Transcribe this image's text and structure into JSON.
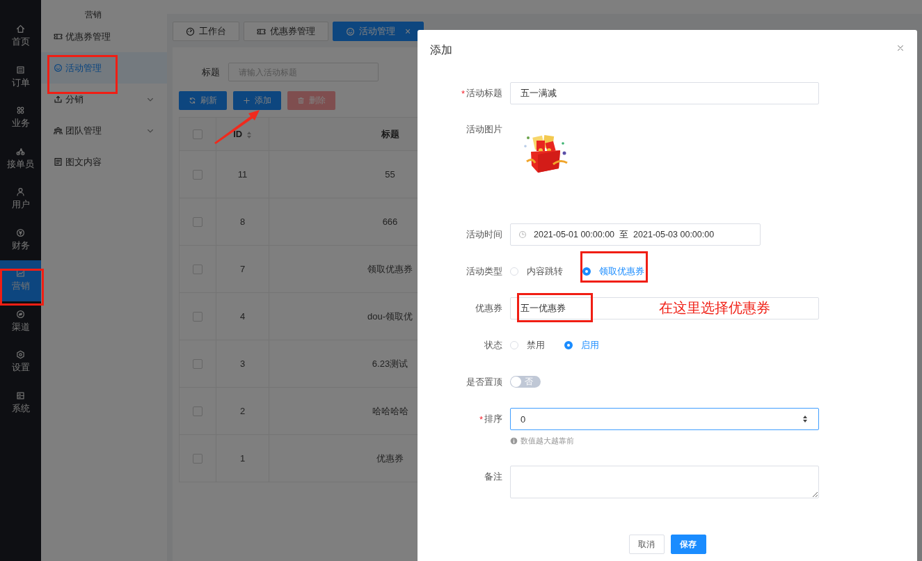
{
  "rail": {
    "items": [
      {
        "label": "首页",
        "selected": false
      },
      {
        "label": "订单",
        "selected": false
      },
      {
        "label": "业务",
        "selected": false
      },
      {
        "label": "接单员",
        "selected": false
      },
      {
        "label": "用户",
        "selected": false
      },
      {
        "label": "财务",
        "selected": false
      },
      {
        "label": "营销",
        "selected": true
      },
      {
        "label": "渠道",
        "selected": false
      },
      {
        "label": "设置",
        "selected": false
      },
      {
        "label": "系统",
        "selected": false
      }
    ]
  },
  "submenu": {
    "heading": "营销",
    "items": [
      {
        "label": "优惠券管理",
        "selected": false,
        "expandable": false
      },
      {
        "label": "活动管理",
        "selected": true,
        "expandable": false
      },
      {
        "label": "分销",
        "selected": false,
        "expandable": true
      },
      {
        "label": "团队管理",
        "selected": false,
        "expandable": true
      },
      {
        "label": "图文内容",
        "selected": false,
        "expandable": false
      }
    ]
  },
  "tabs": [
    {
      "label": "工作台",
      "selected": false,
      "closable": false
    },
    {
      "label": "优惠券管理",
      "selected": false,
      "closable": false
    },
    {
      "label": "活动管理",
      "selected": true,
      "closable": true,
      "close": "×"
    }
  ],
  "filter": {
    "label": "标题",
    "placeholder": "请输入活动标题"
  },
  "toolbar": [
    {
      "label": "刷新",
      "kind": "primary",
      "disabled": false
    },
    {
      "label": "添加",
      "kind": "primary",
      "disabled": false
    },
    {
      "label": "删除",
      "kind": "danger",
      "disabled": true
    }
  ],
  "table": {
    "select_all": false,
    "columns": [
      {
        "label": "ID",
        "sortable": true
      },
      {
        "label": "标题",
        "sortable": false
      }
    ],
    "rows": [
      {
        "id": "11",
        "title": "55",
        "checked": false
      },
      {
        "id": "8",
        "title": "666",
        "checked": false
      },
      {
        "id": "7",
        "title": "领取优惠券",
        "checked": false
      },
      {
        "id": "4",
        "title": "dou-领取优",
        "checked": false
      },
      {
        "id": "3",
        "title": "6.23测试",
        "checked": false
      },
      {
        "id": "2",
        "title": "哈哈哈哈",
        "checked": false
      },
      {
        "id": "1",
        "title": "优惠券",
        "checked": false
      }
    ]
  },
  "modal": {
    "title": "添加",
    "required_mark": "*",
    "fields": [
      {
        "kind": "text",
        "label": "活动标题",
        "required": true,
        "value": "五一满减"
      },
      {
        "label": "活动图片",
        "required": false
      },
      {
        "kind": "daterange",
        "label": "活动时间",
        "required": false,
        "start": "2021-05-01 00:00:00",
        "separator": "至",
        "end": "2021-05-03 00:00:00"
      },
      {
        "kind": "radio",
        "label": "活动类型",
        "required": false,
        "options": [
          {
            "label": "内容跳转",
            "selected": false
          },
          {
            "label": "领取优惠券",
            "selected": true
          }
        ]
      },
      {
        "kind": "select",
        "label": "优惠券",
        "required": false,
        "value": "五一优惠券"
      },
      {
        "kind": "radio",
        "label": "状态",
        "required": false,
        "options": [
          {
            "label": "禁用",
            "selected": false
          },
          {
            "label": "启用",
            "selected": true
          }
        ]
      },
      {
        "kind": "switch",
        "label": "是否置顶",
        "required": false,
        "on": false,
        "text": "否"
      },
      {
        "kind": "number",
        "label": "排序",
        "required": true,
        "value": "0",
        "hint": "数值越大越靠前"
      },
      {
        "kind": "textarea",
        "label": "备注",
        "required": false
      }
    ],
    "buttons": [
      {
        "label": "取消",
        "kind": "default"
      },
      {
        "label": "保存",
        "kind": "primary"
      }
    ]
  },
  "annotation": {
    "note": "在这里选择优惠券"
  }
}
